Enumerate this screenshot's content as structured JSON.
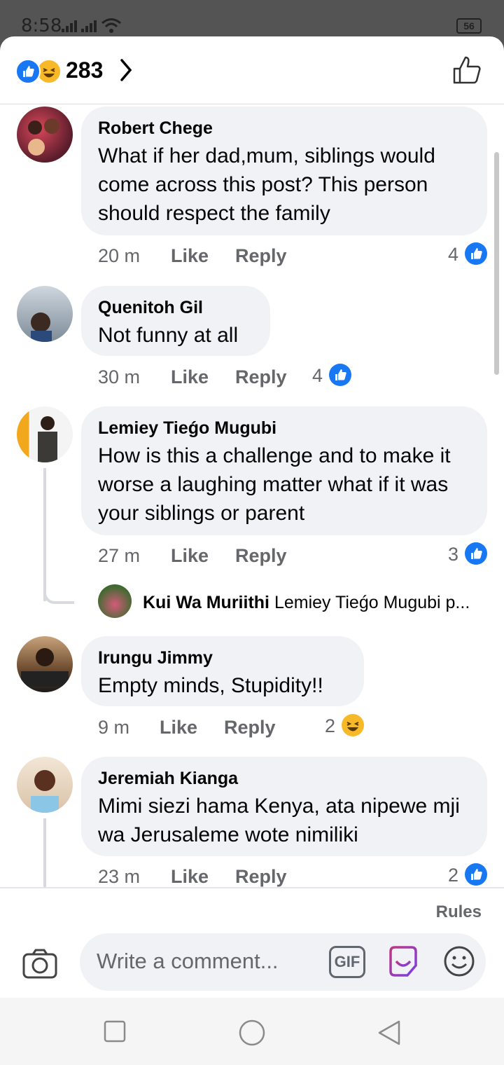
{
  "status_bar": {
    "time": "8:58",
    "battery": "56"
  },
  "header": {
    "reaction_count": "283"
  },
  "comments": [
    {
      "author": "Robert Chege",
      "text": "What if her dad,mum, siblings  would come across this post? This person should respect the family",
      "time": "20 m",
      "like": "Like",
      "reply": "Reply",
      "reactions": "4",
      "reaction_type": "like"
    },
    {
      "author": "Quenitoh Gil",
      "text": "Not funny at all",
      "time": "30 m",
      "like": "Like",
      "reply": "Reply",
      "reactions": "4",
      "reaction_type": "like"
    },
    {
      "author": "Lemiey Tieǵo Mugubi",
      "text": "How is this a challenge and to make it worse a laughing matter what if it was your siblings or parent",
      "time": "27 m",
      "like": "Like",
      "reply": "Reply",
      "reactions": "3",
      "reaction_type": "like",
      "reply_preview": {
        "author": "Kui Wa Muriithi",
        "text": "Lemiey Tieǵo Mugubi p..."
      }
    },
    {
      "author": "Irungu Jimmy",
      "text": "Empty minds, Stupidity!!",
      "time": "9 m",
      "like": "Like",
      "reply": "Reply",
      "reactions": "2",
      "reaction_type": "haha"
    },
    {
      "author": "Jeremiah Kianga",
      "text": "Mimi siezi hama Kenya,  ata nipewe mji wa Jerusaleme wote nimiliki",
      "time": "23 m",
      "like": "Like",
      "reply": "Reply",
      "reactions": "2",
      "reaction_type": "like"
    }
  ],
  "footer": {
    "rules": "Rules",
    "placeholder": "Write a comment...",
    "gif": "GIF"
  },
  "colors": {
    "accent": "#1877f2",
    "haha": "#f7b928",
    "bubble": "#f0f2f5",
    "muted": "#65676b"
  }
}
